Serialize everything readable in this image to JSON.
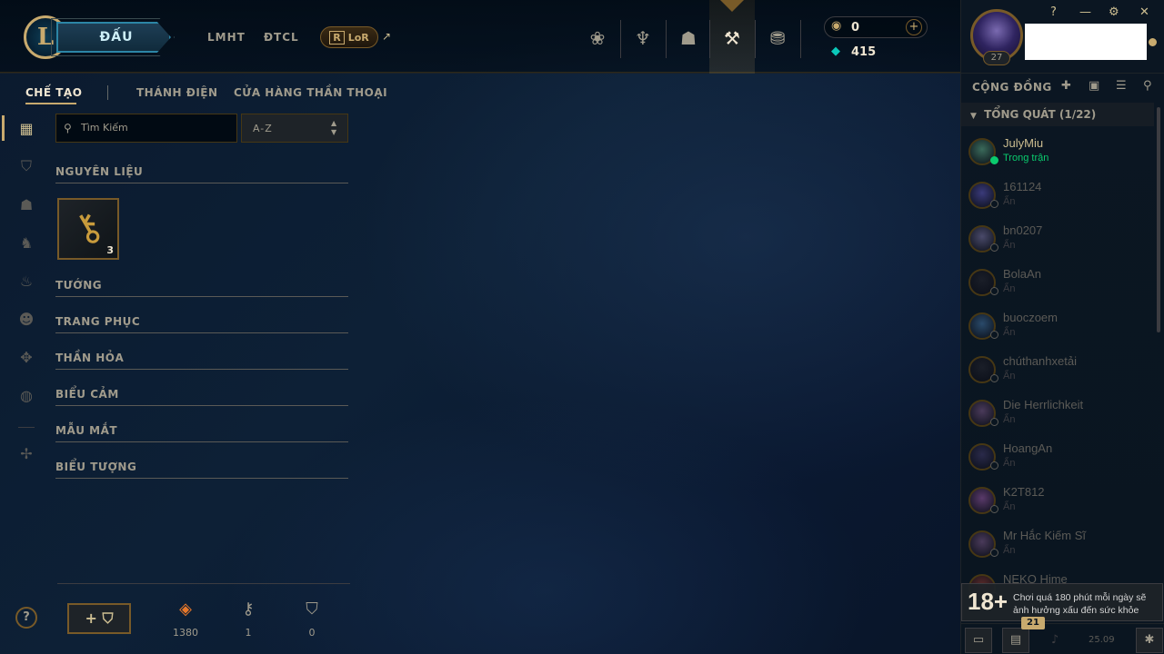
{
  "topnav": {
    "logo_letter": "L",
    "play_label": "ĐẤU",
    "links": [
      "LMHT",
      "ĐTCL"
    ],
    "lor_label": "LoR",
    "lor_letter": "R",
    "lor_arrow": "↗",
    "icons": [
      {
        "name": "home-icon",
        "glyph": "❀"
      },
      {
        "name": "profile-icon",
        "glyph": "♆"
      },
      {
        "name": "collection-icon",
        "glyph": "☗"
      },
      {
        "name": "loot-icon",
        "glyph": "⚒"
      },
      {
        "name": "store-icon",
        "glyph": "⛃"
      }
    ],
    "rp_value": "0",
    "be_value": "415",
    "rp_add": "+"
  },
  "window": {
    "help": "?",
    "minimize": "—",
    "settings": "⚙",
    "close": "✕"
  },
  "profile": {
    "level": "27"
  },
  "subnav": {
    "items": [
      "CHẾ TẠO",
      "THÁNH ĐIỆN",
      "CỬA HÀNG THẦN THOẠI"
    ]
  },
  "filters": {
    "search_placeholder": "Tìm Kiếm",
    "sort_value": "A-Z"
  },
  "categories": [
    "NGUYÊN LIỆU",
    "TƯỚNG",
    "TRANG PHỤC",
    "THẦN HỎA",
    "BIỂU CẢM",
    "MẪU MẮT",
    "BIỂU TƯỢNG"
  ],
  "material_item": {
    "count": "3"
  },
  "resources": {
    "essence": "1380",
    "keys": "1",
    "chests": "0"
  },
  "add_chest_label": "+ ⛉",
  "social": {
    "title": "CỘNG ĐỒNG",
    "group_title": "TỔNG QUÁT (1/22)",
    "friends": [
      {
        "name": "JulyMiu",
        "status": "Trong trận",
        "online": true,
        "color": "#3a6a5a"
      },
      {
        "name": "161124",
        "status": "Ẩn",
        "online": false,
        "color": "#3a3a7a"
      },
      {
        "name": "bn0207",
        "status": "Ẩn",
        "online": false,
        "color": "#4a4a6a"
      },
      {
        "name": "BolaAn",
        "status": "Ẩn",
        "online": false,
        "color": "#1a1e28"
      },
      {
        "name": "buoczoem",
        "status": "Ẩn",
        "online": false,
        "color": "#2a4a6a"
      },
      {
        "name": "chúthanhxetải",
        "status": "Ẩn",
        "online": false,
        "color": "#1a1e28"
      },
      {
        "name": "Die Herrlichkeit",
        "status": "Ẩn",
        "online": false,
        "color": "#4a3a5a"
      },
      {
        "name": "HoangAn",
        "status": "Ẩn",
        "online": false,
        "color": "#2a2a4a"
      },
      {
        "name": "K2T812",
        "status": "Ẩn",
        "online": false,
        "color": "#5a3a6a"
      },
      {
        "name": "Mr Hắc Kiếm Sĩ",
        "status": "Ẩn",
        "online": false,
        "color": "#4a3a5a"
      },
      {
        "name": "NEKO Hime",
        "status": "",
        "online": false,
        "color": "#5a2a2a"
      }
    ],
    "age_rating": "18+",
    "age_warning": "Chơi quá 180 phút mỗi ngày sẽ ảnh hưởng xấu đến sức khỏe",
    "notification_count": "21",
    "version": "25.09"
  }
}
